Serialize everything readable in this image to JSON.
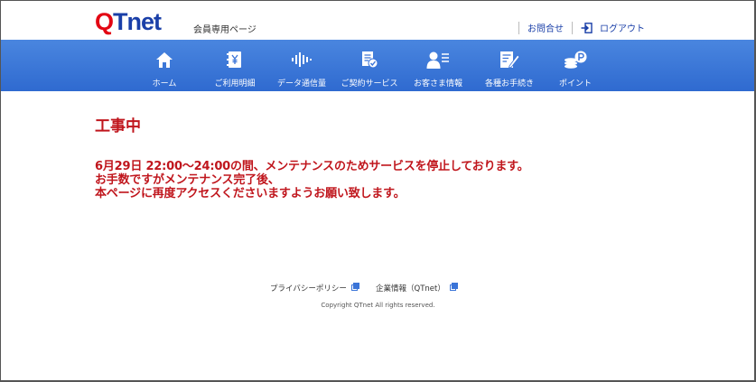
{
  "header": {
    "logo_q": "Q",
    "logo_t": "T",
    "logo_rest": "net",
    "subtitle": "会員専用ページ",
    "contact_label": "お問合せ",
    "logout_label": "ログアウト"
  },
  "nav": {
    "items": [
      {
        "label": "ホーム",
        "icon": "home-icon"
      },
      {
        "label": "ご利用明細",
        "icon": "yen-statement-icon"
      },
      {
        "label": "データ通信量",
        "icon": "data-wave-icon"
      },
      {
        "label": "ご契約サービス",
        "icon": "contract-icon"
      },
      {
        "label": "お客さま情報",
        "icon": "customer-icon"
      },
      {
        "label": "各種お手続き",
        "icon": "procedure-icon"
      },
      {
        "label": "ポイント",
        "icon": "point-coin-icon"
      }
    ]
  },
  "main": {
    "title": "工事中",
    "lines": [
      "6月29日 22:00～24:00の間、メンテナンスのためサービスを停止しております。",
      "お手数ですがメンテナンス完了後、",
      "本ページに再度アクセスくださいますようお願い致します。"
    ]
  },
  "footer": {
    "privacy_label": "プライバシーポリシー",
    "company_label": "企業情報（QTnet）",
    "copyright": "Copyright QTnet All rights reserved."
  },
  "colors": {
    "brand_blue": "#1a3fa8",
    "brand_red": "#e30613",
    "nav_blue": "#3a74d8",
    "alert_red": "#c0161d"
  }
}
